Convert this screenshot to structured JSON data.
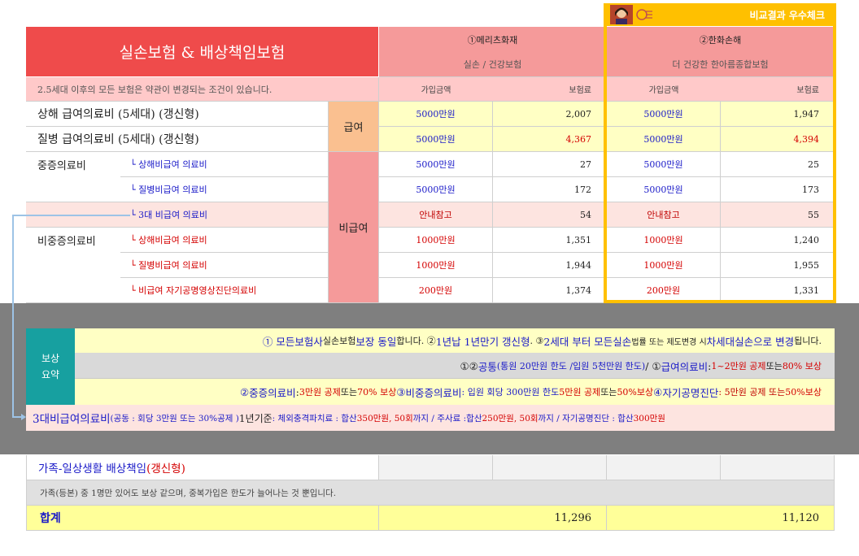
{
  "header": {
    "title": "실손보험 & 배상책임보험",
    "col1_name": "①메리츠화재",
    "col1_product": "실손 / 건강보험",
    "col2_name": "②한화손해",
    "col2_product": "더 건강한 한아름종합보험",
    "badge": "비교결과 우수체크",
    "notice": "2.5세대 이후의 모든 보험은 약관이 변경되는 조건이 있습니다.",
    "sub_amount": "가입금액",
    "sub_premium": "보험료"
  },
  "groups": {
    "benefit": "급여",
    "nonbenefit": "비급여"
  },
  "rows": [
    {
      "label": "상해 급여의료비 (5세대) (갱신형)",
      "sub": "",
      "c1_amount": "5000만원",
      "c1_premium": "2,007",
      "c2_amount": "5000만원",
      "c2_premium": "1,947"
    },
    {
      "label": "질병 급여의료비 (5세대) (갱신형)",
      "sub": "",
      "c1_amount": "5000만원",
      "c1_premium": "4,367",
      "c2_amount": "5000만원",
      "c2_premium": "4,394"
    },
    {
      "label": "중증의료비",
      "sub": "└ 상해비급여 의료비",
      "c1_amount": "5000만원",
      "c1_premium": "27",
      "c2_amount": "5000만원",
      "c2_premium": "25"
    },
    {
      "label": "",
      "sub": "└ 질병비급여 의료비",
      "c1_amount": "5000만원",
      "c1_premium": "172",
      "c2_amount": "5000만원",
      "c2_premium": "173"
    },
    {
      "label": "",
      "sub": "└ 3대 비급여 의료비",
      "c1_amount": "안내참고",
      "c1_premium": "54",
      "c2_amount": "안내참고",
      "c2_premium": "55"
    },
    {
      "label": "비중증의료비",
      "sub": "└ 상해비급여 의료비",
      "c1_amount": "1000만원",
      "c1_premium": "1,351",
      "c2_amount": "1000만원",
      "c2_premium": "1,240"
    },
    {
      "label": "",
      "sub": "└ 질병비급여 의료비",
      "c1_amount": "1000만원",
      "c1_premium": "1,944",
      "c2_amount": "1000만원",
      "c2_premium": "1,955"
    },
    {
      "label": "",
      "sub": "└ 비급여 자기공명영상진단의료비",
      "c1_amount": "200만원",
      "c1_premium": "1,374",
      "c2_amount": "200만원",
      "c2_premium": "1,331"
    }
  ],
  "summary": {
    "label_line1": "보상",
    "label_line2": "요약",
    "line1": {
      "a": "① 모든보험사",
      "b": " 실손보험 ",
      "c": "보장 동일",
      "d": "합니다. ② ",
      "e": "1년납 1년만기 갱신형",
      "f": ". ③ ",
      "g": "2세대 부터 모든실손",
      "h": " 법률 또는 제도변경 시 ",
      "i": "차세대실손으로 변경",
      "j": " 됩니다."
    },
    "line2": {
      "a": "①② ",
      "b": "공통",
      "c": "(통원 20만원 한도 /입원 5천만원 한도)",
      "d": " / ① ",
      "e": "급여의료비",
      "f": " : ",
      "g": "1~2만원 공제",
      "h": " 또는 ",
      "i": "80% 보상"
    },
    "line3": {
      "a": "② ",
      "b": "중증의료비",
      "c": " : ",
      "d": "3만원 공제",
      "e": " 또는 ",
      "f": "70% 보상",
      "g": " ③ ",
      "h": "비중증의료비",
      "i": " : 입원 회당 300만원 한도 ",
      "j": "5만원 공제",
      "k": " 또는 ",
      "l": "50%보상",
      "m": " ④ ",
      "n": "자기공명진단",
      "o": " : 5만원 공제 또는 ",
      "p": "50%보상"
    },
    "line4": {
      "a": "3대비급여의료비",
      "b": " (공동 : 회당 3만원 또는 30%공제 ) ",
      "c": "1년기준",
      "d": " : 체외충격파치료 : 합산 ",
      "e": "350만원, 50회",
      "f": "까지  / 주사료 :합산 ",
      "g": "250만원, 50회",
      "h": "까지 / 자기공명진단 : 합산 ",
      "i": "300만원"
    }
  },
  "liability": {
    "label": "가족-일상생활 배상책임",
    "renew": " (갱신형)",
    "note": "가족(등본) 중 1명만 있어도 보상 같으며, 중복가입은 한도가 늘어나는 것 뿐입니다."
  },
  "total": {
    "label": "합계",
    "c1": "11,296",
    "c2": "11,120"
  },
  "colors": {
    "title_bg": "#ef4b4b",
    "header_bg": "#f59a9a",
    "highlight_border": "#ffc000",
    "summary_bg": "#7f7f7f",
    "teal": "#17a0a0"
  }
}
